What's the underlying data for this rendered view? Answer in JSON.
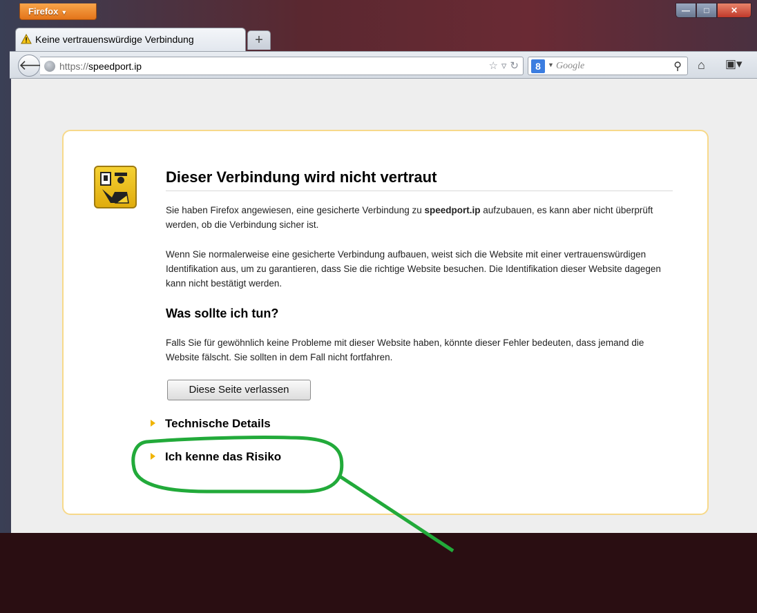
{
  "browser": {
    "menu_label": "Firefox",
    "menu_arrow": "▼",
    "tab_title": "Keine vertrauenswürdige Verbindung",
    "new_tab_symbol": "+",
    "url_scheme": "https://",
    "url_host": "speedport.ip",
    "search_engine_icon": "8",
    "search_placeholder": "Google"
  },
  "window_controls": {
    "minimize": "—",
    "maximize": "□",
    "close": "✕"
  },
  "page": {
    "title": "Dieser Verbindung wird nicht vertraut",
    "p1_before": "Sie haben Firefox angewiesen, eine gesicherte Verbindung zu ",
    "p1_host": "speedport.ip",
    "p1_after": " aufzubauen, es kann aber nicht überprüft werden, ob die Verbindung sicher ist.",
    "p2": "Wenn Sie normalerweise eine gesicherte Verbindung aufbauen, weist sich die Website mit einer vertrauenswürdigen Identifikation aus, um zu garantieren, dass Sie die richtige Website besuchen. Die Identifikation dieser Website dagegen kann nicht bestätigt werden.",
    "what_to_do": "Was sollte ich tun?",
    "p3": "Falls Sie für gewöhnlich keine Probleme mit dieser Website haben, könnte dieser Fehler bedeuten, dass jemand die Website fälscht. Sie sollten in dem Fall nicht fortfahren.",
    "leave_button": "Diese Seite verlassen",
    "technical_details": "Technische Details",
    "understand_risks": "Ich kenne das Risiko"
  },
  "icons": {
    "tab": "warning-triangle-icon",
    "url": "globe-icon",
    "cert": "policeman-certificate-icon"
  },
  "colors": {
    "annotation_green": "#22aa3a",
    "expander_triangle": "#f0b400",
    "box_border": "#f7d98a",
    "firefox_button": "#e3741a"
  }
}
